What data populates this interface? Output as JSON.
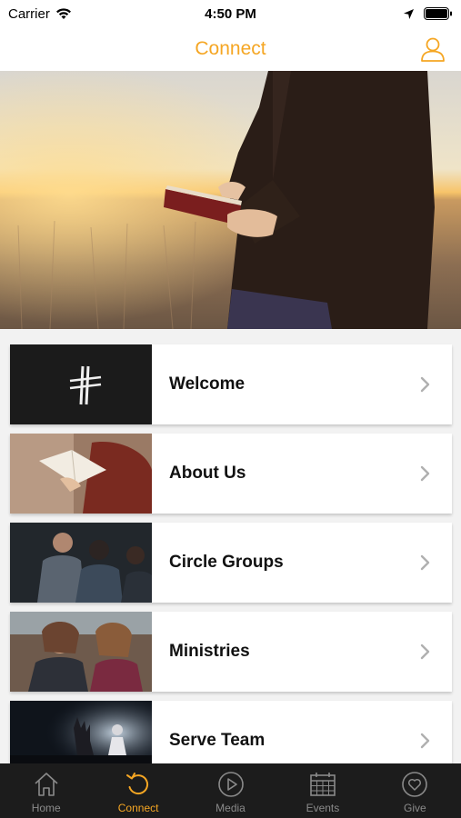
{
  "status_bar": {
    "carrier": "Carrier",
    "time": "4:50 PM"
  },
  "nav": {
    "title": "Connect",
    "accent_color": "#f5a623"
  },
  "list": {
    "items": [
      {
        "label": "Welcome",
        "thumb_icon": "cross-logo"
      },
      {
        "label": "About Us",
        "thumb_icon": "bible-reading-photo"
      },
      {
        "label": "Circle Groups",
        "thumb_icon": "group-praying-photo"
      },
      {
        "label": "Ministries",
        "thumb_icon": "friends-smiling-photo"
      },
      {
        "label": "Serve Team",
        "thumb_icon": "worship-hands-photo"
      }
    ]
  },
  "tab_bar": {
    "active_color": "#f5a623",
    "inactive_color": "#8a8a8a",
    "tabs": [
      {
        "label": "Home",
        "icon": "home-icon",
        "active": false
      },
      {
        "label": "Connect",
        "icon": "refresh-icon",
        "active": true
      },
      {
        "label": "Media",
        "icon": "play-icon",
        "active": false
      },
      {
        "label": "Events",
        "icon": "calendar-icon",
        "active": false
      },
      {
        "label": "Give",
        "icon": "heart-icon",
        "active": false
      }
    ]
  }
}
